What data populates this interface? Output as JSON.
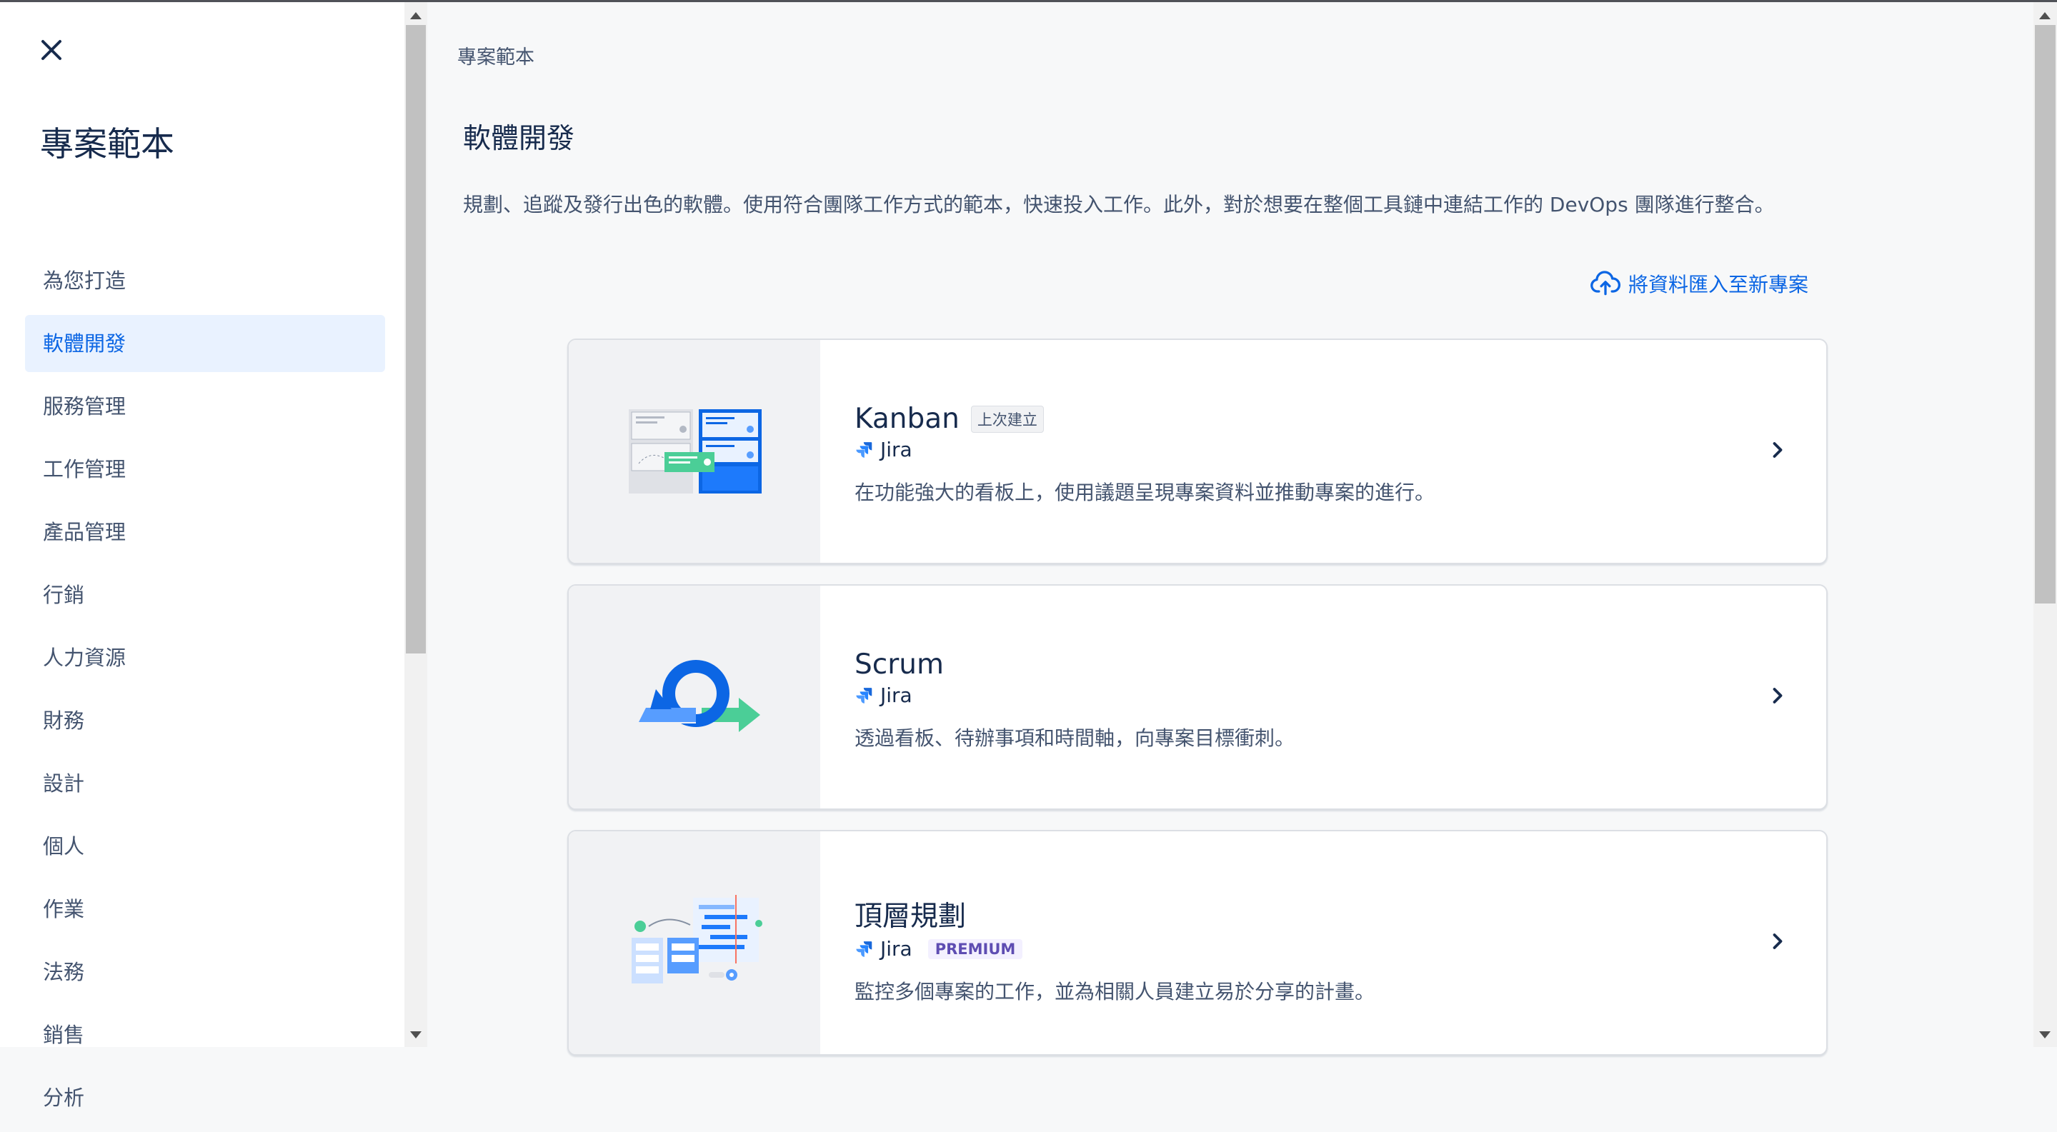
{
  "sidebar": {
    "title": "專案範本",
    "items": [
      {
        "label": "為您打造"
      },
      {
        "label": "軟體開發"
      },
      {
        "label": "服務管理"
      },
      {
        "label": "工作管理"
      },
      {
        "label": "產品管理"
      },
      {
        "label": "行銷"
      },
      {
        "label": "人力資源"
      },
      {
        "label": "財務"
      },
      {
        "label": "設計"
      },
      {
        "label": "個人"
      },
      {
        "label": "作業"
      },
      {
        "label": "法務"
      },
      {
        "label": "銷售"
      },
      {
        "label": "分析"
      }
    ],
    "active_index": 1
  },
  "main": {
    "breadcrumb": "專案範本",
    "title": "軟體開發",
    "description": "規劃、追蹤及發行出色的軟體。使用符合團隊工作方式的範本，快速投入工作。此外，對於想要在整個工具鏈中連結工作的 DevOps 團隊進行整合。",
    "import_label": "將資料匯入至新專案",
    "cards": [
      {
        "name": "Kanban",
        "tag": "上次建立",
        "product": "Jira",
        "description": "在功能強大的看板上，使用議題呈現專案資料並推動專案的進行。"
      },
      {
        "name": "Scrum",
        "product": "Jira",
        "description": "透過看板、待辦事項和時間軸，向專案目標衝刺。"
      },
      {
        "name": "頂層規劃",
        "product": "Jira",
        "badge": "PREMIUM",
        "description": "監控多個專案的工作，並為相關人員建立易於分享的計畫。"
      }
    ]
  },
  "colors": {
    "accent": "#0c66e4",
    "active_bg": "#e9f2ff",
    "text": "#172b4d",
    "subtle_text": "#44546f",
    "premium": "#5e4db2"
  }
}
